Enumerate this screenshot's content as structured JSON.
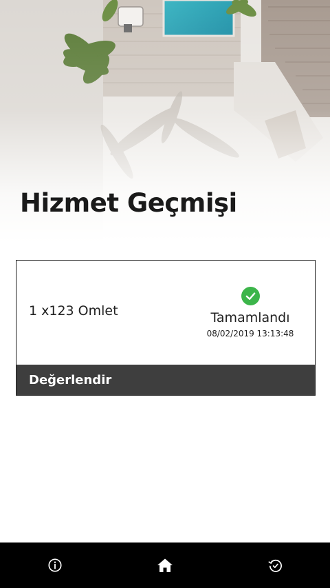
{
  "page": {
    "title": "Hizmet Geçmişi"
  },
  "history": [
    {
      "item": "1 x123 Omlet",
      "status": "Tamamlandı",
      "datetime": "08/02/2019 13:13:48",
      "action_label": "Değerlendir"
    }
  ],
  "bottom_nav": {
    "items": [
      {
        "id": "info",
        "icon": "info-icon"
      },
      {
        "id": "home",
        "icon": "home-icon"
      },
      {
        "id": "history",
        "icon": "history-icon"
      }
    ]
  },
  "colors": {
    "status_ok": "#3cb54a",
    "action_bar": "#3e3e3e",
    "nav_bar": "#000000",
    "title": "#1a1a1a"
  }
}
